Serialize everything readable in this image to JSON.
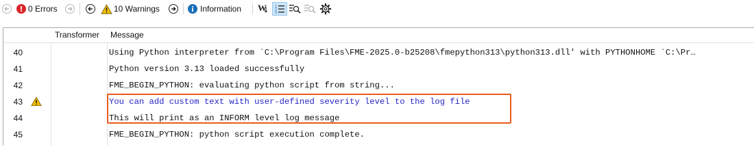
{
  "toolbar": {
    "errors_label": "0 Errors",
    "warnings_label": "10 Warnings",
    "information_label": "Information"
  },
  "columns": {
    "transformer": "Transformer",
    "message": "Message"
  },
  "rows": [
    {
      "num": "40",
      "msg": "Using Python interpreter from `C:\\Program Files\\FME-2025.0-b25208\\fmepython313\\python313.dll' with PYTHONHOME `C:\\Pr…",
      "level": "info"
    },
    {
      "num": "41",
      "msg": "Python version 3.13 loaded successfully",
      "level": "info"
    },
    {
      "num": "42",
      "msg": "FME_BEGIN_PYTHON: evaluating python script from string...",
      "level": "info"
    },
    {
      "num": "43",
      "msg": "You can add custom text with user-defined severity level to the log file",
      "level": "warning"
    },
    {
      "num": "44",
      "msg": "This will print as an INFORM level log message",
      "level": "info"
    },
    {
      "num": "45",
      "msg": "FME_BEGIN_PYTHON: python script execution complete.",
      "level": "info"
    }
  ],
  "colors": {
    "error": "#d9262a",
    "warning": "#f2c200",
    "info": "#1c70b8",
    "highlight": "#ea5a1c",
    "warning_text": "#2525c8"
  }
}
